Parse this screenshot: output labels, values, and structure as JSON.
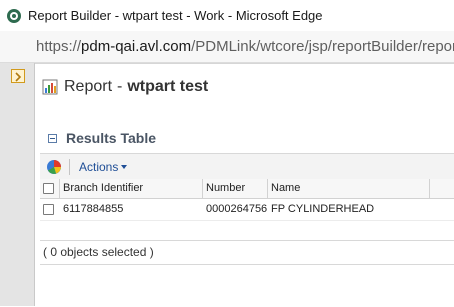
{
  "window": {
    "title": "Report Builder - wtpart test - Work - Microsoft Edge"
  },
  "address": {
    "prefix": "https://",
    "host": "pdm-qai.avl.com",
    "path": "/PDMLink/wtcore/jsp/reportBuilder/repor"
  },
  "report": {
    "label": "Report",
    "dash": "-",
    "name": "wtpart test"
  },
  "results": {
    "title": "Results Table",
    "toolbar": {
      "actions_label": "Actions"
    },
    "columns": [
      "Branch Identifier",
      "Number",
      "Name"
    ],
    "rows": [
      {
        "branch_identifier": "6117884855",
        "number": "0000264756",
        "name": "FP CYLINDERHEAD"
      }
    ],
    "footer": "( 0 objects selected )"
  },
  "colors": {
    "accent_link": "#1f4e96",
    "section_title": "#4a5564"
  }
}
